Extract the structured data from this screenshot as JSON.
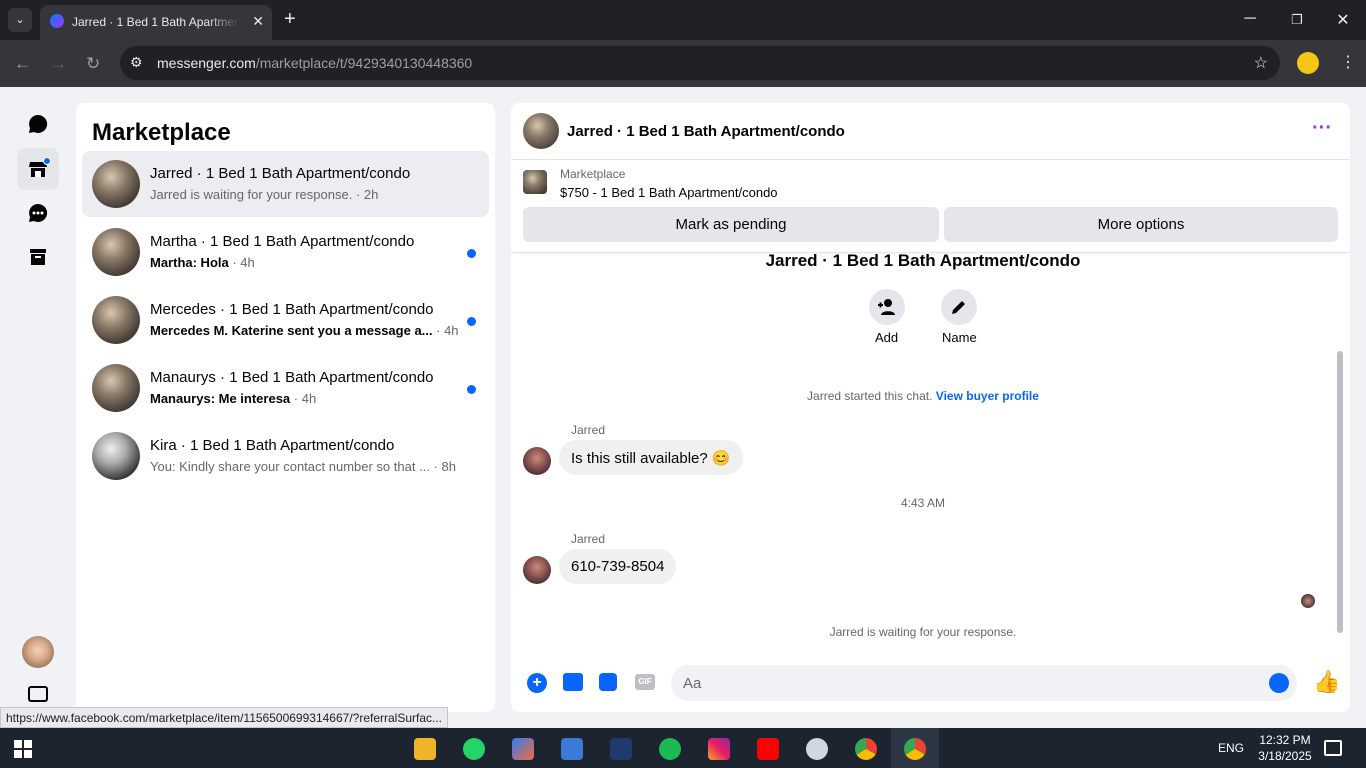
{
  "browser": {
    "tab_title": "Jarred · 1 Bed 1 Bath Apartment/condo",
    "url_host": "messenger.com",
    "url_path": "/marketplace/t/9429340130448360",
    "status_url": "https://www.facebook.com/marketplace/item/1156500699314667/?referralSurfac..."
  },
  "list": {
    "heading": "Marketplace",
    "conversations": [
      {
        "name": "Jarred · 1 Bed 1 Bath Apartment/condo",
        "preview": "Jarred is waiting for your response.",
        "time": "· 2h",
        "unread": false,
        "active": true
      },
      {
        "name": "Martha · 1 Bed 1 Bath Apartment/condo",
        "preview": "Martha: Hola",
        "time": "· 4h",
        "unread": true,
        "active": false
      },
      {
        "name": "Mercedes · 1 Bed 1 Bath Apartment/condo",
        "preview": "Mercedes M. Katerine sent you a message a...",
        "time": "· 4h",
        "unread": true,
        "active": false
      },
      {
        "name": "Manaurys · 1 Bed 1 Bath Apartment/condo",
        "preview": "Manaurys: Me interesa",
        "time": "· 4h",
        "unread": true,
        "active": false
      },
      {
        "name": "Kira · 1 Bed 1 Bath Apartment/condo",
        "preview": "You: Kindly share your contact number so that ...",
        "time": "· 8h",
        "unread": false,
        "active": false
      }
    ]
  },
  "chat": {
    "header_title": "Jarred · 1 Bed 1 Bath Apartment/condo",
    "listing_label": "Marketplace",
    "listing_title": "$750 - 1 Bed 1 Bath Apartment/condo",
    "mark_pending": "Mark as pending",
    "more_options": "More options",
    "thread_title": "Jarred · 1 Bed 1 Bath Apartment/condo",
    "add_label": "Add",
    "name_label": "Name",
    "started_text": "Jarred started this chat.",
    "view_profile": "View buyer profile",
    "sender1": "Jarred",
    "msg1": "Is this still available? 😊",
    "timestamp": "4:43 AM",
    "sender2": "Jarred",
    "msg2": "610-739-8504",
    "waiting": "Jarred is waiting for your response.",
    "composer_placeholder": "Aa"
  },
  "taskbar": {
    "time": "12:32 PM",
    "date": "3/18/2025",
    "lang": "ENG"
  },
  "colors": {
    "accent": "#0866ff",
    "link": "#0866ff"
  }
}
